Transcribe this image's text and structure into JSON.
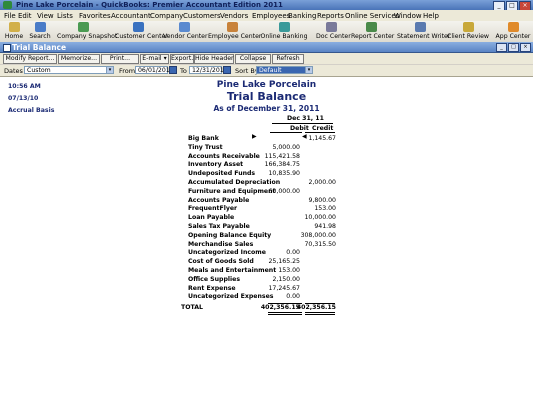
{
  "window": {
    "title": "Pine Lake Porcelain - QuickBooks: Premier Accountant Edition 2011"
  },
  "menu": [
    "File",
    "Edit",
    "View",
    "Lists",
    "Favorites",
    "Accountant",
    "Company",
    "Customers",
    "Vendors",
    "Employees",
    "Banking",
    "Reports",
    "Online Services",
    "Window",
    "Help"
  ],
  "toolbar": [
    {
      "label": "Home",
      "icon": "home-icon",
      "color": "#d2b04a"
    },
    {
      "label": "Search",
      "icon": "search-icon",
      "color": "#4a7cc8"
    },
    {
      "label": "Company Snapshot",
      "icon": "snapshot-icon",
      "color": "#4a9a52"
    },
    {
      "label": "Customer Center",
      "icon": "customer-icon",
      "color": "#3a72c0"
    },
    {
      "label": "Vendor Center",
      "icon": "vendor-icon",
      "color": "#5a8ad0"
    },
    {
      "label": "Employee Center",
      "icon": "employee-icon",
      "color": "#c8823a"
    },
    {
      "label": "Online Banking",
      "icon": "bank-icon",
      "color": "#3a9a9a"
    },
    {
      "label": "Doc Center",
      "icon": "doc-icon",
      "color": "#7a7a9a"
    },
    {
      "label": "Report Center",
      "icon": "report-icon",
      "color": "#4a8a4a"
    },
    {
      "label": "Statement Writer",
      "icon": "statement-icon",
      "color": "#5a7ab0"
    },
    {
      "label": "Client Review",
      "icon": "review-icon",
      "color": "#c8a83a"
    },
    {
      "label": "App Center",
      "icon": "app-icon",
      "color": "#e08a2a"
    }
  ],
  "report_window": {
    "title": "Trial Balance"
  },
  "report_buttons": [
    "Modify Report...",
    "Memorize...",
    "Print...",
    "E-mail ▾",
    "Export...",
    "Hide Header",
    "Collapse",
    "Refresh"
  ],
  "filters": {
    "dates_label": "Dates",
    "dates_value": "Custom",
    "from_label": "From",
    "from_value": "06/01/2010",
    "to_label": "To",
    "to_value": "12/31/2011",
    "sort_label": "Sort By",
    "sort_value": "Default"
  },
  "report": {
    "time": "10:56 AM",
    "date": "07/13/10",
    "basis": "Accrual Basis",
    "company": "Pine Lake Porcelain",
    "title": "Trial Balance",
    "subtitle": "As of December 31, 2011",
    "period_header": "Dec 31, 11",
    "col_debit": "Debit",
    "col_credit": "Credit",
    "rows": [
      {
        "account": "Big Bank",
        "debit": "",
        "credit": "1,145.67"
      },
      {
        "account": "Tiny Trust",
        "debit": "5,000.00",
        "credit": ""
      },
      {
        "account": "Accounts Receivable",
        "debit": "115,421.58",
        "credit": ""
      },
      {
        "account": "Inventory Asset",
        "debit": "166,384.75",
        "credit": ""
      },
      {
        "account": "Undeposited Funds",
        "debit": "10,835.90",
        "credit": ""
      },
      {
        "account": "Accumulated Depreciation",
        "debit": "",
        "credit": "2,000.00"
      },
      {
        "account": "Furniture and Equipment",
        "debit": "60,000.00",
        "credit": ""
      },
      {
        "account": "Accounts Payable",
        "debit": "",
        "credit": "9,800.00"
      },
      {
        "account": "FrequentFlyer",
        "debit": "",
        "credit": "153.00"
      },
      {
        "account": "Loan Payable",
        "debit": "",
        "credit": "10,000.00"
      },
      {
        "account": "Sales Tax Payable",
        "debit": "",
        "credit": "941.98"
      },
      {
        "account": "Opening Balance Equity",
        "debit": "",
        "credit": "308,000.00"
      },
      {
        "account": "Merchandise Sales",
        "debit": "",
        "credit": "70,315.50"
      },
      {
        "account": "Uncategorized Income",
        "debit": "0.00",
        "credit": ""
      },
      {
        "account": "Cost of Goods Sold",
        "debit": "25,165.25",
        "credit": ""
      },
      {
        "account": "Meals and Entertainment",
        "debit": "153.00",
        "credit": ""
      },
      {
        "account": "Office Supplies",
        "debit": "2,150.00",
        "credit": ""
      },
      {
        "account": "Rent Expense",
        "debit": "17,245.67",
        "credit": ""
      },
      {
        "account": "Uncategorized Expenses",
        "debit": "0.00",
        "credit": ""
      }
    ],
    "total_label": "TOTAL",
    "total_debit": "402,356.15",
    "total_credit": "402,356.15"
  }
}
